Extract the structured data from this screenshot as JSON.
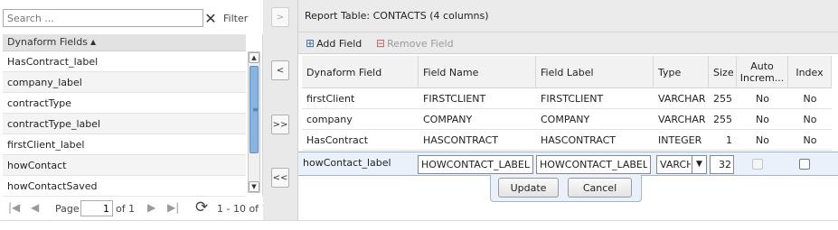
{
  "left": {
    "search": {
      "placeholder": "Search ...",
      "value": ""
    },
    "clear_label": "✕",
    "filter_label": "Filter",
    "header": "Dynaform Fields",
    "sort_icon": "▲",
    "items": [
      {
        "label": "HasContract_label"
      },
      {
        "label": "company_label"
      },
      {
        "label": "contractType"
      },
      {
        "label": "contractType_label"
      },
      {
        "label": "firstClient_label"
      },
      {
        "label": "howContact"
      },
      {
        "label": "howContactSaved"
      }
    ],
    "scrollbar": {
      "up": "▲",
      "down": "▼",
      "grip": "≡"
    },
    "pager": {
      "first_icon": "|◀",
      "prev_icon": "◀",
      "page_label": "Page",
      "page_value": "1",
      "of_label": "of 1",
      "next_icon": "▶",
      "last_icon": "▶|",
      "refresh_icon": "⟳",
      "status": "1 - 10 of 1"
    }
  },
  "middle": {
    "add_all": ">",
    "add": "<",
    "remove_all_right": ">>",
    "remove_all_left": "<<"
  },
  "right": {
    "title": "Report Table: CONTACTS (4 columns)",
    "toolbar": {
      "add_field": "Add Field",
      "add_icon": "⊞",
      "remove_field": "Remove Field",
      "remove_icon": "⊟"
    },
    "columns": [
      "Dynaform Field",
      "Field Name",
      "Field Label",
      "Type",
      "Size",
      "Auto Increm...",
      "Index"
    ],
    "rows": [
      {
        "dyn": "firstClient",
        "name": "FIRSTCLIENT",
        "label": "FIRSTCLIENT",
        "type": "VARCHAR",
        "size": "255",
        "auto": "No",
        "index": "No"
      },
      {
        "dyn": "company",
        "name": "COMPANY",
        "label": "COMPANY",
        "type": "VARCHAR",
        "size": "255",
        "auto": "No",
        "index": "No"
      },
      {
        "dyn": "HasContract",
        "name": "HASCONTRACT",
        "label": "HASCONTRACT",
        "type": "INTEGER",
        "size": "1",
        "auto": "No",
        "index": "No"
      }
    ],
    "editor": {
      "dyn": "howContact_label",
      "name": "HOWCONTACT_LABEL",
      "label": "HOWCONTACT_LABEL",
      "type": "VARCH",
      "type_arrow": "▼",
      "size": "32",
      "update": "Update",
      "cancel": "Cancel"
    }
  }
}
